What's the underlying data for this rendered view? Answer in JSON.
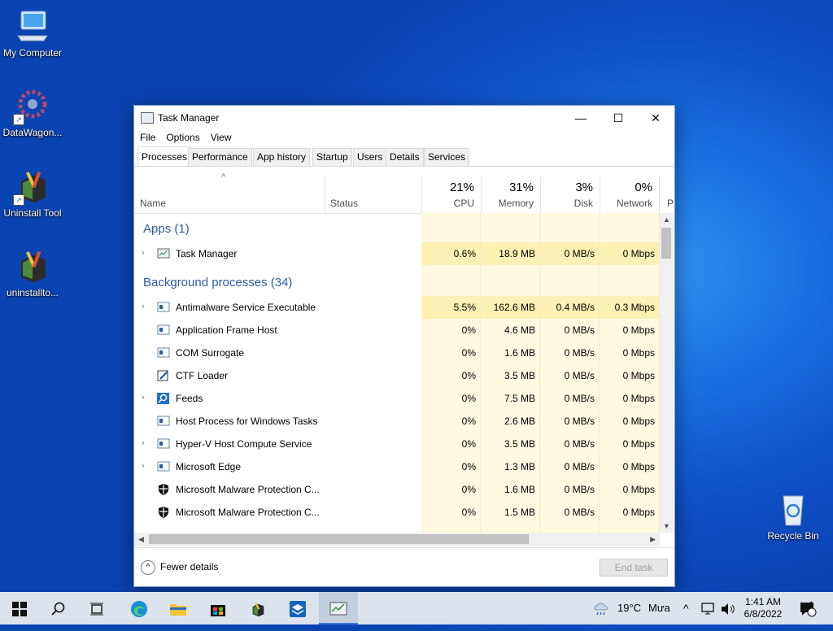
{
  "desktop": {
    "icons": [
      {
        "label": "My Computer"
      },
      {
        "label": "DataWagon..."
      },
      {
        "label": "Uninstall Tool"
      },
      {
        "label": "uninstallto..."
      },
      {
        "label": "Recycle Bin"
      }
    ]
  },
  "window": {
    "title": "Task Manager",
    "minimize": "—",
    "maximize": "☐",
    "close": "✕"
  },
  "menu": {
    "file": "File",
    "options": "Options",
    "view": "View"
  },
  "tabs": [
    "Processes",
    "Performance",
    "App history",
    "Startup",
    "Users",
    "Details",
    "Services"
  ],
  "columns": {
    "name": "Name",
    "status": "Status",
    "cpu": {
      "pct": "21%",
      "label": "CPU"
    },
    "memory": {
      "pct": "31%",
      "label": "Memory"
    },
    "disk": {
      "pct": "3%",
      "label": "Disk"
    },
    "network": {
      "pct": "0%",
      "label": "Network"
    },
    "power": "P"
  },
  "groups": {
    "apps": "Apps (1)",
    "background": "Background processes (34)"
  },
  "apps": [
    {
      "name": "Task Manager",
      "cpu": "0.6%",
      "memory": "18.9 MB",
      "disk": "0 MB/s",
      "network": "0 Mbps"
    }
  ],
  "background": [
    {
      "name": "Antimalware Service Executable",
      "cpu": "5.5%",
      "memory": "162.6 MB",
      "disk": "0.4 MB/s",
      "network": "0.3 Mbps"
    },
    {
      "name": "Application Frame Host",
      "cpu": "0%",
      "memory": "4.6 MB",
      "disk": "0 MB/s",
      "network": "0 Mbps"
    },
    {
      "name": "COM Surrogate",
      "cpu": "0%",
      "memory": "1.6 MB",
      "disk": "0 MB/s",
      "network": "0 Mbps"
    },
    {
      "name": "CTF Loader",
      "cpu": "0%",
      "memory": "3.5 MB",
      "disk": "0 MB/s",
      "network": "0 Mbps"
    },
    {
      "name": "Feeds",
      "cpu": "0%",
      "memory": "7.5 MB",
      "disk": "0 MB/s",
      "network": "0 Mbps"
    },
    {
      "name": "Host Process for Windows Tasks",
      "cpu": "0%",
      "memory": "2.6 MB",
      "disk": "0 MB/s",
      "network": "0 Mbps"
    },
    {
      "name": "Hyper-V Host Compute Service",
      "cpu": "0%",
      "memory": "3.5 MB",
      "disk": "0 MB/s",
      "network": "0 Mbps"
    },
    {
      "name": "Microsoft Edge",
      "cpu": "0%",
      "memory": "1.3 MB",
      "disk": "0 MB/s",
      "network": "0 Mbps"
    },
    {
      "name": "Microsoft Malware Protection C...",
      "cpu": "0%",
      "memory": "1.6 MB",
      "disk": "0 MB/s",
      "network": "0 Mbps"
    },
    {
      "name": "Microsoft Malware Protection C...",
      "cpu": "0%",
      "memory": "1.5 MB",
      "disk": "0 MB/s",
      "network": "0 Mbps"
    }
  ],
  "footer": {
    "fewer": "Fewer details",
    "end_task": "End task"
  },
  "taskbar": {
    "weather_temp": "19°C",
    "weather_text": "Mưa",
    "time": "1:41 AM",
    "date": "6/8/2022",
    "notif_count": "1"
  },
  "colors": {
    "accent": "#2d5d9f",
    "heat_light": "#fff9e0",
    "heat_mid": "#fdf0b4"
  }
}
